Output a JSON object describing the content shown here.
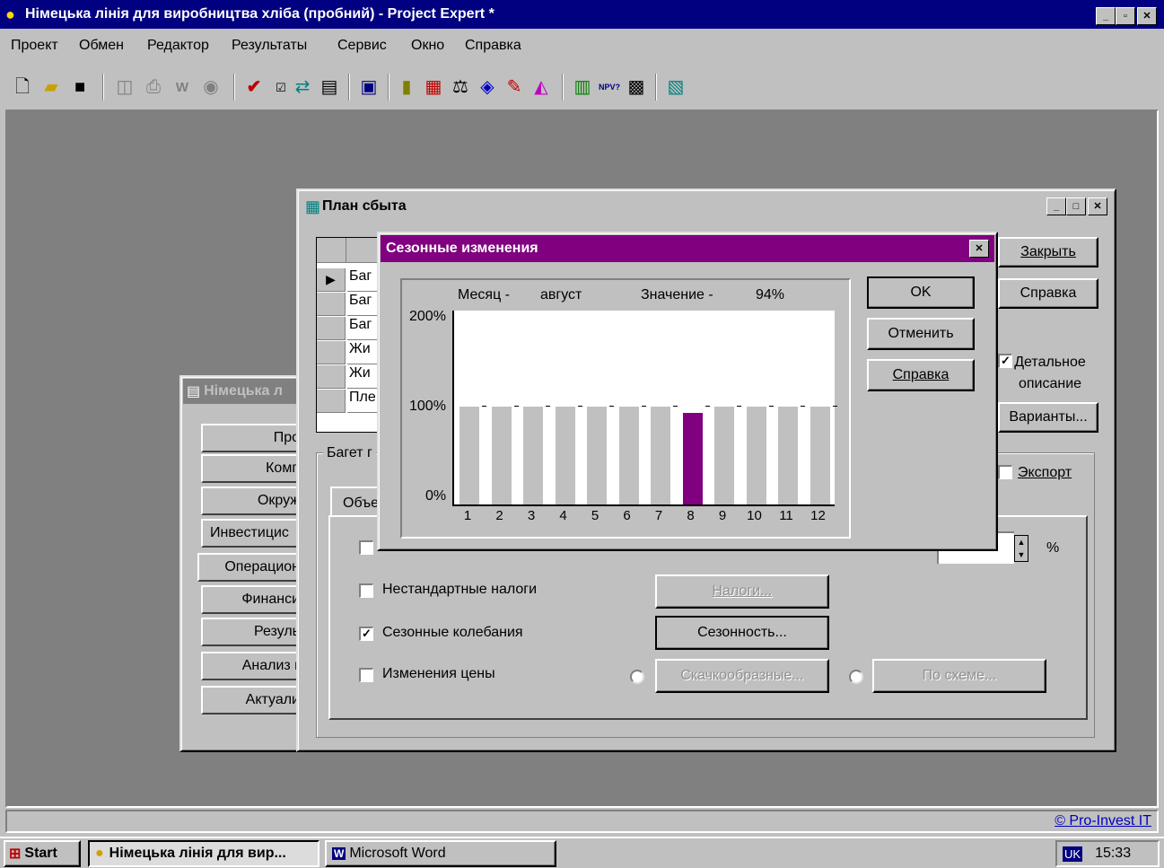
{
  "app": {
    "title": "Німецька лінія для виробництва хліба (пробний) - Project Expert *",
    "brand_color": "#000080"
  },
  "menu": [
    "Проект",
    "Обмен",
    "Редактор",
    "Результаты",
    "Сервис",
    "Окно",
    "Справка"
  ],
  "toolbar_icons": [
    "new-file-icon",
    "open-folder-icon",
    "save-icon",
    "print-preview-icon",
    "print-icon",
    "word-export-icon",
    "export-icon",
    "check-icon",
    "swap-icon",
    "calculate-icon",
    "list-icon",
    "report-icon",
    "book-icon",
    "cashflow-icon",
    "balance-icon",
    "analysis-icon",
    "editor-icon",
    "chart-icon",
    "bar-chart-icon",
    "npv-pi-icon",
    "sensitivity-icon",
    "database-icon"
  ],
  "bg_window": {
    "title": "Німецька л",
    "tabs": [
      "Про",
      "Комп",
      "Окруж",
      "Инвестицис",
      "Операцион",
      "Финанси",
      "Резуль",
      "Анализ г",
      "Актуали"
    ]
  },
  "sales_window": {
    "title": "План сбыта",
    "rows": [
      "Баг",
      "Баг",
      "Баг",
      "Жи",
      "Жи",
      "Пле"
    ],
    "buttons": {
      "close": "Закрыть",
      "help": "Справка",
      "variants": "Варианты..."
    },
    "detail_label": "Детальное описание",
    "export_label": "Экспорт",
    "group_label": "Багет г",
    "tab_label": "Объе",
    "percent": "%",
    "options": [
      {
        "label": "Нестандартные налоги",
        "checked": false,
        "button": "Налоги...",
        "enabled": false
      },
      {
        "label": "Сезонные колебания",
        "checked": true,
        "button": "Сезонность...",
        "enabled": true
      },
      {
        "label": "Изменения цены",
        "checked": false
      }
    ],
    "price_buttons": [
      "Скачкообразные...",
      "По схеме..."
    ]
  },
  "dialog": {
    "title": "Сезонные изменения",
    "title_color": "#800080",
    "buttons": {
      "ok": "OK",
      "cancel": "Отменить",
      "help": "Справка"
    }
  },
  "chart_data": {
    "type": "bar",
    "month_label": "Месяц -",
    "month_value": "август",
    "value_label": "Значение -",
    "value_value": "94%",
    "y_ticks": [
      "200%",
      "100%",
      "0%"
    ],
    "ylim": [
      0,
      200
    ],
    "categories": [
      "1",
      "2",
      "3",
      "4",
      "5",
      "6",
      "7",
      "8",
      "9",
      "10",
      "11",
      "12"
    ],
    "values": [
      100,
      100,
      100,
      100,
      100,
      100,
      100,
      94,
      100,
      100,
      100,
      100
    ],
    "selected_index": 7,
    "bar_color": "#c0c0c0",
    "selected_color": "#800080"
  },
  "status": {
    "copyright": "© Pro-Invest IT"
  },
  "taskbar": {
    "start": "Start",
    "tasks": [
      "Німецька лінія для вир...",
      "Microsoft Word"
    ],
    "lang": "UK",
    "clock": "15:33"
  }
}
